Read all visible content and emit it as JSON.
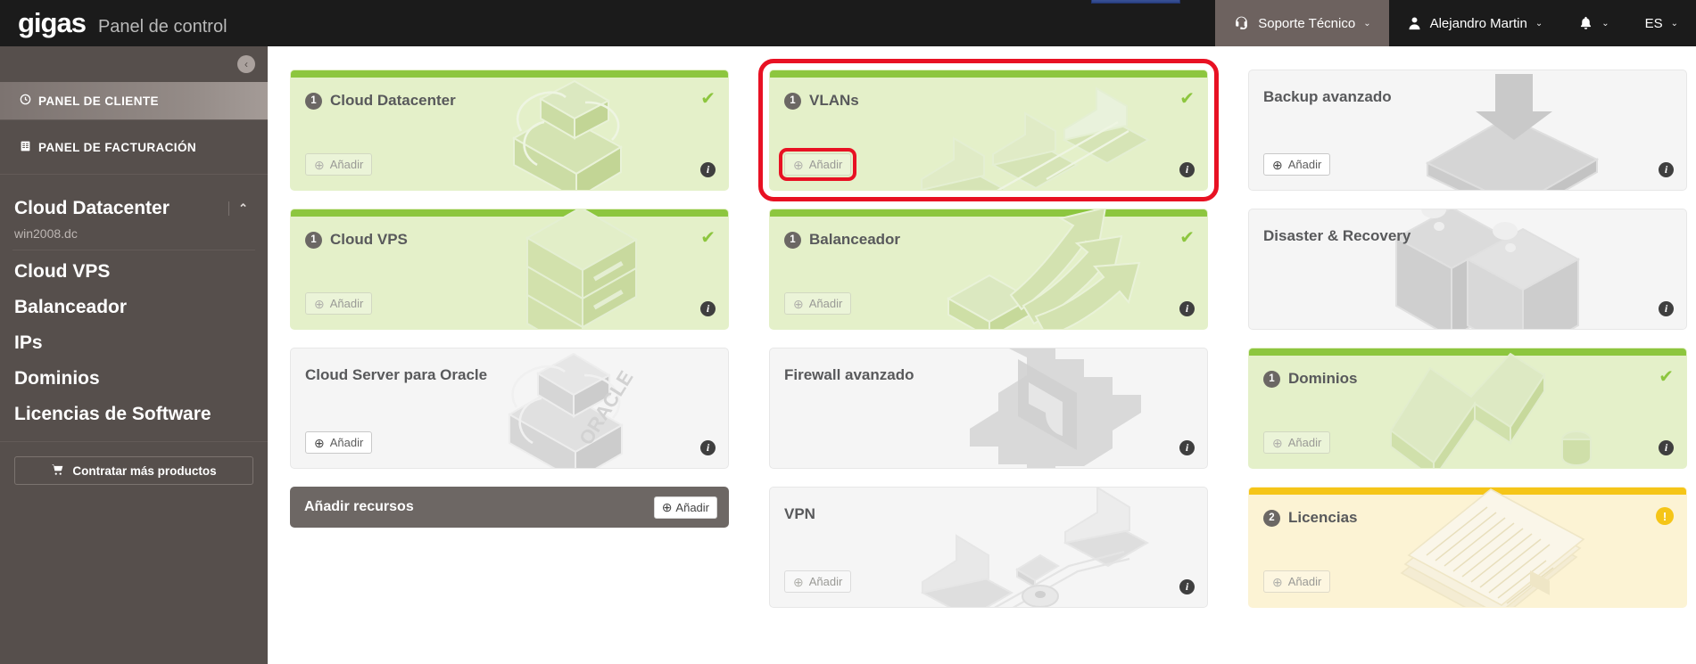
{
  "topbar": {
    "brand": "gigas",
    "subtitle": "Panel de control",
    "support_label": "Soporte Técnico",
    "user_label": "Alejandro Martin",
    "lang_label": "ES",
    "caret": "⌄"
  },
  "sidebar": {
    "collapse_icon": "‹",
    "panel_cliente": "PANEL DE CLIENTE",
    "panel_facturacion": "PANEL DE FACTURACIÓN",
    "items": [
      {
        "label": "Cloud Datacenter",
        "sub": "win2008.dc",
        "chevron": "⌃"
      },
      {
        "label": "Cloud VPS",
        "sub": "",
        "chevron": ""
      },
      {
        "label": "Balanceador",
        "sub": "",
        "chevron": ""
      },
      {
        "label": "IPs",
        "sub": "",
        "chevron": ""
      },
      {
        "label": "Dominios",
        "sub": "",
        "chevron": ""
      },
      {
        "label": "Licencias de Software",
        "sub": "",
        "chevron": ""
      }
    ],
    "cta": "Contratar más productos"
  },
  "main": {
    "add_label": "Añadir",
    "resources_bar": {
      "label": "Añadir recursos",
      "button": "Añadir"
    },
    "cards": [
      {
        "title": "Cloud Datacenter",
        "count": "1",
        "state": "green",
        "status": "check",
        "add": "dim",
        "art": "racks",
        "info": true
      },
      {
        "title": "VLANs",
        "count": "1",
        "state": "green",
        "status": "check",
        "add": "dim",
        "art": "laptops",
        "info": true,
        "highlight": true
      },
      {
        "title": "Backup avanzado",
        "count": "",
        "state": "plain",
        "status": "none",
        "add": "solid",
        "art": "backup",
        "info": true
      },
      {
        "title": "Cloud VPS",
        "count": "1",
        "state": "green",
        "status": "check",
        "add": "dim",
        "art": "tower",
        "info": true
      },
      {
        "title": "Balanceador",
        "count": "1",
        "state": "green",
        "status": "check",
        "add": "dim",
        "art": "arrows",
        "info": true
      },
      {
        "title": "Disaster & Recovery",
        "count": "",
        "state": "plain",
        "status": "none",
        "add": "none",
        "art": "boxes",
        "info": true
      },
      {
        "title": "Cloud Server para Oracle",
        "count": "",
        "state": "plain",
        "status": "none",
        "add": "solid",
        "art": "oracle",
        "info": true
      },
      {
        "title": "Firewall avanzado",
        "count": "",
        "state": "plain",
        "status": "none",
        "add": "none",
        "art": "shield",
        "info": true
      },
      {
        "title": "Dominios",
        "count": "1",
        "state": "green",
        "status": "check",
        "add": "dim",
        "art": "www",
        "info": true
      },
      {
        "title": "VPN",
        "count": "",
        "state": "plain",
        "status": "none",
        "add": "dim",
        "art": "vpn",
        "info": true
      },
      {
        "title": "Licencias",
        "count": "2",
        "state": "yellow",
        "status": "warn",
        "add": "dim",
        "art": "papers",
        "info": false
      }
    ],
    "icons": {
      "check": "✔",
      "warn": "!",
      "info": "i",
      "plus": "⊕"
    }
  },
  "colors": {
    "green_accent": "#8dc63f",
    "green_bg": "#e4f0c9",
    "yellow_accent": "#f5c518",
    "yellow_bg": "#fcf3d4",
    "sidebar_bg": "#564f4c",
    "topbar_bg": "#1b1b1b",
    "highlight_red": "#e81123"
  }
}
